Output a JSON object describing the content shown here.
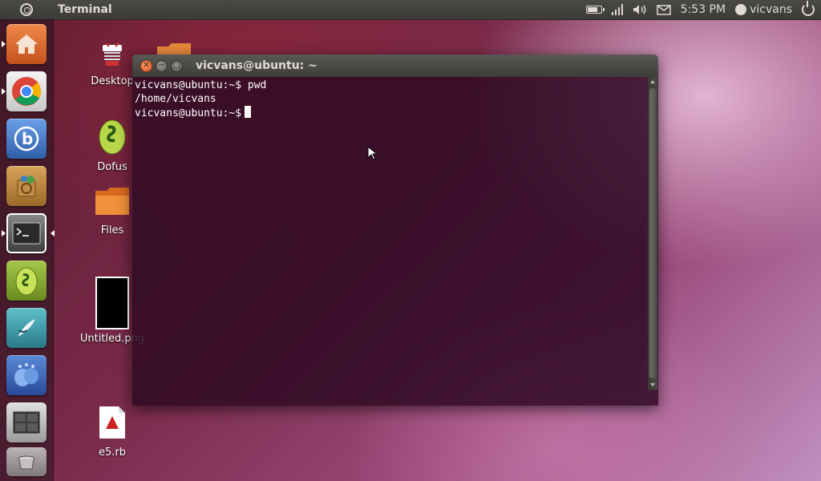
{
  "top_panel": {
    "app_title": "Terminal",
    "clock": "5:53 PM",
    "user_name": "vicvans"
  },
  "launcher": {
    "items": [
      {
        "name": "home-folder",
        "color": "#e0672c"
      },
      {
        "name": "chrome",
        "color": "#d9d9d9"
      },
      {
        "name": "blue-app",
        "color": "#3f74c8"
      },
      {
        "name": "software-center",
        "color": "#c58b3d"
      },
      {
        "name": "terminal",
        "color": "#3a3a3a"
      },
      {
        "name": "dofus",
        "color": "#8fb23a"
      },
      {
        "name": "writer-app",
        "color": "#3ba8b8"
      },
      {
        "name": "empathy",
        "color": "#3d6fbd"
      },
      {
        "name": "workspace-switcher",
        "color": "#bdbdbd"
      }
    ]
  },
  "desktop_icons": {
    "desktop": "Desktop",
    "dofus": "Dofus",
    "files": "Files",
    "untitled_png": "Untitled.png",
    "e5_rb": "e5.rb"
  },
  "terminal": {
    "title": "vicvans@ubuntu: ~",
    "lines": [
      "vicvans@ubuntu:~$ pwd",
      "/home/vicvans"
    ],
    "prompt": "vicvans@ubuntu:~$"
  }
}
